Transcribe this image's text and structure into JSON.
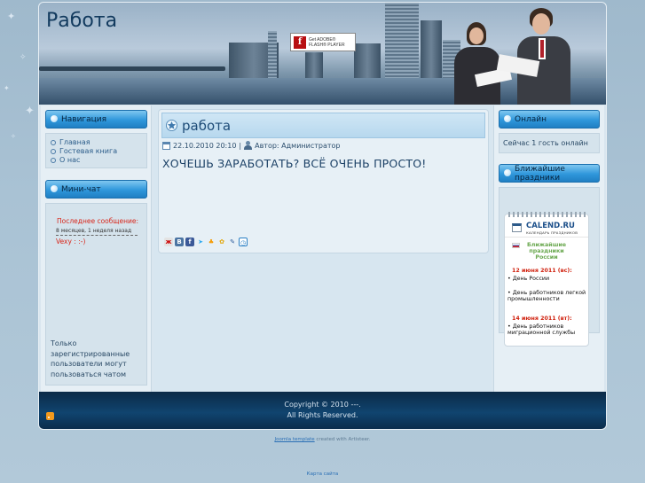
{
  "site": {
    "title": "Работа",
    "flash_badge": {
      "line1": "Get ADOBE®",
      "line2": "FLASH® PLAYER"
    }
  },
  "navigation": {
    "title": "Навигация",
    "items": [
      {
        "label": "Главная"
      },
      {
        "label": "Гостевая книга"
      },
      {
        "label": "О нас"
      }
    ]
  },
  "chat": {
    "title": "Мини-чат",
    "last_message_label": "Последнее сообщение:",
    "last_message_time": "8 месяцев, 1 неделя назад",
    "last_message_author": "Vexy",
    "last_message_text": ": :-)",
    "login_notice": "Только зарегистрированные пользователи могут пользоваться чатом"
  },
  "post": {
    "title": "работа",
    "date": "22.10.2010 20:10",
    "separator": "|",
    "author": "Автор: Администратор",
    "heading": "ХОЧЕШЬ ЗАРАБОТАТЬ? ВСЁ ОЧЕНЬ ПРОСТО!",
    "share_icons": [
      "bookmark-icon",
      "vkontakte-icon",
      "facebook-icon",
      "twitter-icon",
      "odnoklassniki-icon",
      "moimir-icon",
      "livejournal-icon",
      "liveinternet-icon"
    ]
  },
  "online": {
    "title": "Онлайн",
    "text": "Сейчас 1 гость онлайн"
  },
  "holidays": {
    "title": "Ближайшие праздники",
    "widget_logo": "CALEND.RU",
    "widget_sub": "КАЛЕНДАРЬ  ПРАЗДНИКОВ",
    "widget_title": "Ближайшие праздники России",
    "date1": "12 июня 2011 (вс):",
    "event1": "День России",
    "event2": "День работников легкой промышленности",
    "date2": "14 июня 2011 (вт):",
    "event3": "День работников миграционной службы",
    "bullet": "•"
  },
  "footer": {
    "copyright": "Copyright © 2010 ---.",
    "rights": "All Rights Reserved."
  },
  "credit": {
    "link": "Joomla template",
    "text": "created with Artisteer."
  },
  "sitemap": "Карта сайта"
}
